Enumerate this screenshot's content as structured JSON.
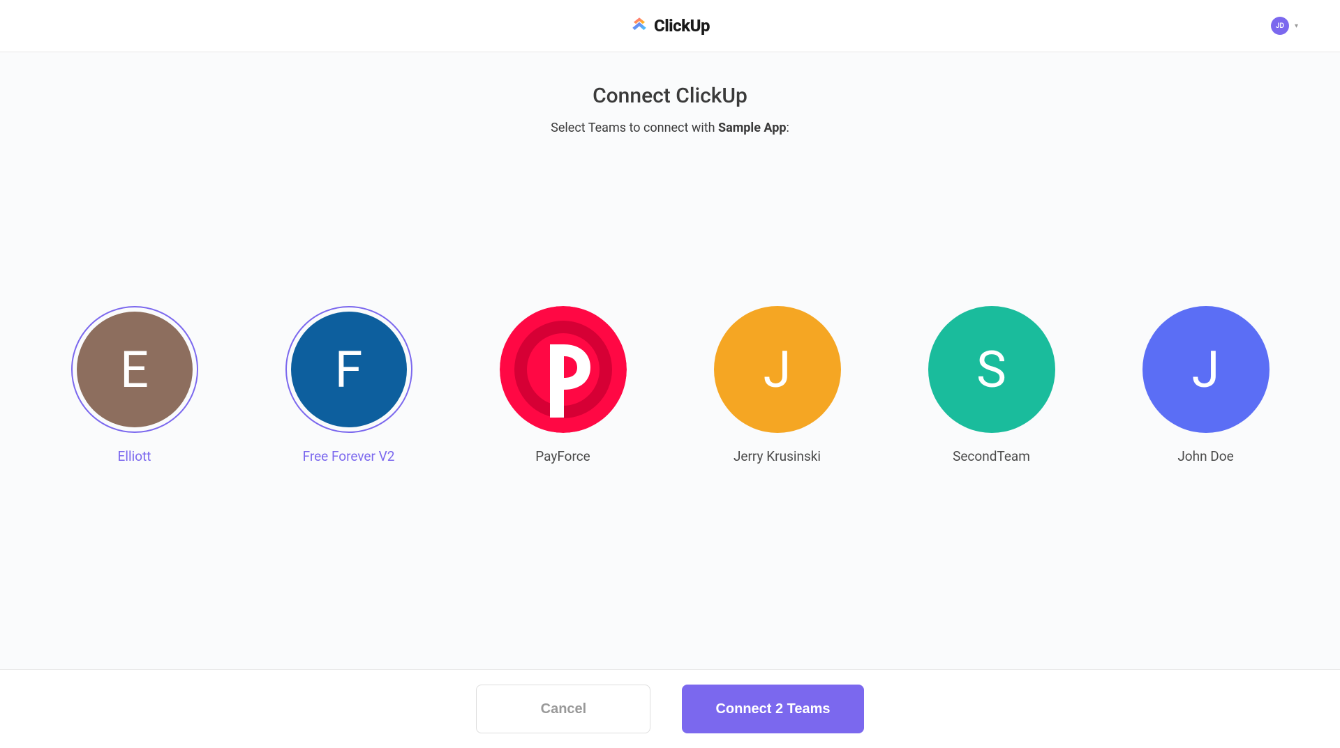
{
  "header": {
    "logo_text": "ClickUp",
    "user_initials": "JD"
  },
  "page": {
    "title": "Connect ClickUp",
    "subtitle_prefix": "Select Teams to connect with ",
    "subtitle_app": "Sample App",
    "subtitle_suffix": ":"
  },
  "teams": [
    {
      "label": "Elliott",
      "initial": "E",
      "color": "#8d6e5e",
      "selected": true,
      "logo": null
    },
    {
      "label": "Free Forever V2",
      "initial": "F",
      "color": "#0d5f9e",
      "selected": true,
      "logo": null
    },
    {
      "label": "PayForce",
      "initial": "",
      "color": "#ff0844",
      "selected": false,
      "logo": "payforce"
    },
    {
      "label": "Jerry Krusinski",
      "initial": "J",
      "color": "#f5a623",
      "selected": false,
      "logo": null
    },
    {
      "label": "SecondTeam",
      "initial": "S",
      "color": "#1abc9c",
      "selected": false,
      "logo": null
    },
    {
      "label": "John Doe",
      "initial": "J",
      "color": "#5b6ef5",
      "selected": false,
      "logo": null
    }
  ],
  "footer": {
    "cancel_label": "Cancel",
    "connect_label": "Connect 2 Teams"
  }
}
